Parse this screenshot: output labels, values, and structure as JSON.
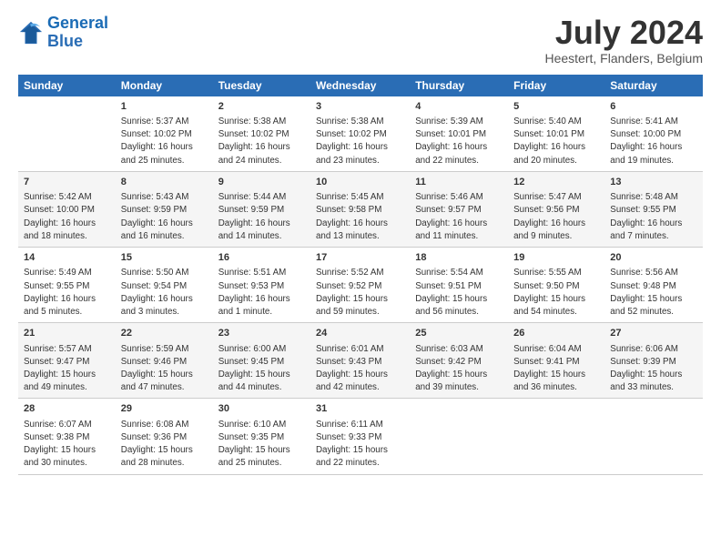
{
  "header": {
    "logo_line1": "General",
    "logo_line2": "Blue",
    "month": "July 2024",
    "location": "Heestert, Flanders, Belgium"
  },
  "columns": [
    "Sunday",
    "Monday",
    "Tuesday",
    "Wednesday",
    "Thursday",
    "Friday",
    "Saturday"
  ],
  "weeks": [
    [
      {
        "day": "",
        "text": ""
      },
      {
        "day": "1",
        "text": "Sunrise: 5:37 AM\nSunset: 10:02 PM\nDaylight: 16 hours\nand 25 minutes."
      },
      {
        "day": "2",
        "text": "Sunrise: 5:38 AM\nSunset: 10:02 PM\nDaylight: 16 hours\nand 24 minutes."
      },
      {
        "day": "3",
        "text": "Sunrise: 5:38 AM\nSunset: 10:02 PM\nDaylight: 16 hours\nand 23 minutes."
      },
      {
        "day": "4",
        "text": "Sunrise: 5:39 AM\nSunset: 10:01 PM\nDaylight: 16 hours\nand 22 minutes."
      },
      {
        "day": "5",
        "text": "Sunrise: 5:40 AM\nSunset: 10:01 PM\nDaylight: 16 hours\nand 20 minutes."
      },
      {
        "day": "6",
        "text": "Sunrise: 5:41 AM\nSunset: 10:00 PM\nDaylight: 16 hours\nand 19 minutes."
      }
    ],
    [
      {
        "day": "7",
        "text": "Sunrise: 5:42 AM\nSunset: 10:00 PM\nDaylight: 16 hours\nand 18 minutes."
      },
      {
        "day": "8",
        "text": "Sunrise: 5:43 AM\nSunset: 9:59 PM\nDaylight: 16 hours\nand 16 minutes."
      },
      {
        "day": "9",
        "text": "Sunrise: 5:44 AM\nSunset: 9:59 PM\nDaylight: 16 hours\nand 14 minutes."
      },
      {
        "day": "10",
        "text": "Sunrise: 5:45 AM\nSunset: 9:58 PM\nDaylight: 16 hours\nand 13 minutes."
      },
      {
        "day": "11",
        "text": "Sunrise: 5:46 AM\nSunset: 9:57 PM\nDaylight: 16 hours\nand 11 minutes."
      },
      {
        "day": "12",
        "text": "Sunrise: 5:47 AM\nSunset: 9:56 PM\nDaylight: 16 hours\nand 9 minutes."
      },
      {
        "day": "13",
        "text": "Sunrise: 5:48 AM\nSunset: 9:55 PM\nDaylight: 16 hours\nand 7 minutes."
      }
    ],
    [
      {
        "day": "14",
        "text": "Sunrise: 5:49 AM\nSunset: 9:55 PM\nDaylight: 16 hours\nand 5 minutes."
      },
      {
        "day": "15",
        "text": "Sunrise: 5:50 AM\nSunset: 9:54 PM\nDaylight: 16 hours\nand 3 minutes."
      },
      {
        "day": "16",
        "text": "Sunrise: 5:51 AM\nSunset: 9:53 PM\nDaylight: 16 hours\nand 1 minute."
      },
      {
        "day": "17",
        "text": "Sunrise: 5:52 AM\nSunset: 9:52 PM\nDaylight: 15 hours\nand 59 minutes."
      },
      {
        "day": "18",
        "text": "Sunrise: 5:54 AM\nSunset: 9:51 PM\nDaylight: 15 hours\nand 56 minutes."
      },
      {
        "day": "19",
        "text": "Sunrise: 5:55 AM\nSunset: 9:50 PM\nDaylight: 15 hours\nand 54 minutes."
      },
      {
        "day": "20",
        "text": "Sunrise: 5:56 AM\nSunset: 9:48 PM\nDaylight: 15 hours\nand 52 minutes."
      }
    ],
    [
      {
        "day": "21",
        "text": "Sunrise: 5:57 AM\nSunset: 9:47 PM\nDaylight: 15 hours\nand 49 minutes."
      },
      {
        "day": "22",
        "text": "Sunrise: 5:59 AM\nSunset: 9:46 PM\nDaylight: 15 hours\nand 47 minutes."
      },
      {
        "day": "23",
        "text": "Sunrise: 6:00 AM\nSunset: 9:45 PM\nDaylight: 15 hours\nand 44 minutes."
      },
      {
        "day": "24",
        "text": "Sunrise: 6:01 AM\nSunset: 9:43 PM\nDaylight: 15 hours\nand 42 minutes."
      },
      {
        "day": "25",
        "text": "Sunrise: 6:03 AM\nSunset: 9:42 PM\nDaylight: 15 hours\nand 39 minutes."
      },
      {
        "day": "26",
        "text": "Sunrise: 6:04 AM\nSunset: 9:41 PM\nDaylight: 15 hours\nand 36 minutes."
      },
      {
        "day": "27",
        "text": "Sunrise: 6:06 AM\nSunset: 9:39 PM\nDaylight: 15 hours\nand 33 minutes."
      }
    ],
    [
      {
        "day": "28",
        "text": "Sunrise: 6:07 AM\nSunset: 9:38 PM\nDaylight: 15 hours\nand 30 minutes."
      },
      {
        "day": "29",
        "text": "Sunrise: 6:08 AM\nSunset: 9:36 PM\nDaylight: 15 hours\nand 28 minutes."
      },
      {
        "day": "30",
        "text": "Sunrise: 6:10 AM\nSunset: 9:35 PM\nDaylight: 15 hours\nand 25 minutes."
      },
      {
        "day": "31",
        "text": "Sunrise: 6:11 AM\nSunset: 9:33 PM\nDaylight: 15 hours\nand 22 minutes."
      },
      {
        "day": "",
        "text": ""
      },
      {
        "day": "",
        "text": ""
      },
      {
        "day": "",
        "text": ""
      }
    ]
  ]
}
